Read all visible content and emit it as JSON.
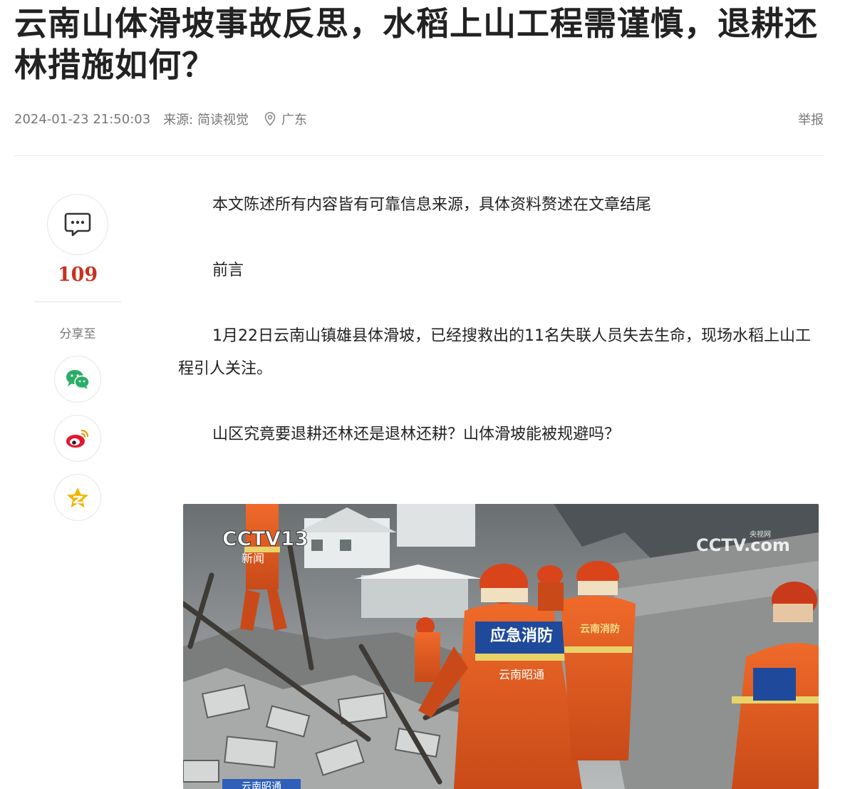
{
  "article": {
    "title": "云南山体滑坡事故反思，水稻上山工程需谨慎，退耕还林措施如何？",
    "meta": {
      "time": "2024-01-23 21:50:03",
      "source": "来源: 简读视觉",
      "location": "广东",
      "report_label": "举报"
    },
    "paragraphs": [
      "本文陈述所有内容皆有可靠信息来源，具体资料赘述在文章结尾",
      "前言",
      "1月22日云南山镇雄县体滑坡，已经搜救出的11名失联人员失去生命，现场水稻上山工程引人关注。",
      "山区究竟要退耕还林还是退林还耕？山体滑坡能被规避吗？"
    ],
    "photo": {
      "logo_left": "CCTV13",
      "logo_left_sub": "新闻",
      "logo_right": "CCTV.com",
      "logo_right_small": "央视网",
      "badge_text": "应急消防",
      "badge_sub": "云南昭通",
      "helmet_text": "云南消防",
      "bottom_text": "云南昭通"
    }
  },
  "sidebar": {
    "comment_count": "109",
    "share_label": "分享至",
    "share_targets": [
      "wechat-icon",
      "weibo-icon",
      "qzone-icon"
    ]
  },
  "colors": {
    "accent": "#c8321e",
    "wechat": "#2aae67",
    "weibo": "#e6162d",
    "qzone": "#f5b400"
  }
}
